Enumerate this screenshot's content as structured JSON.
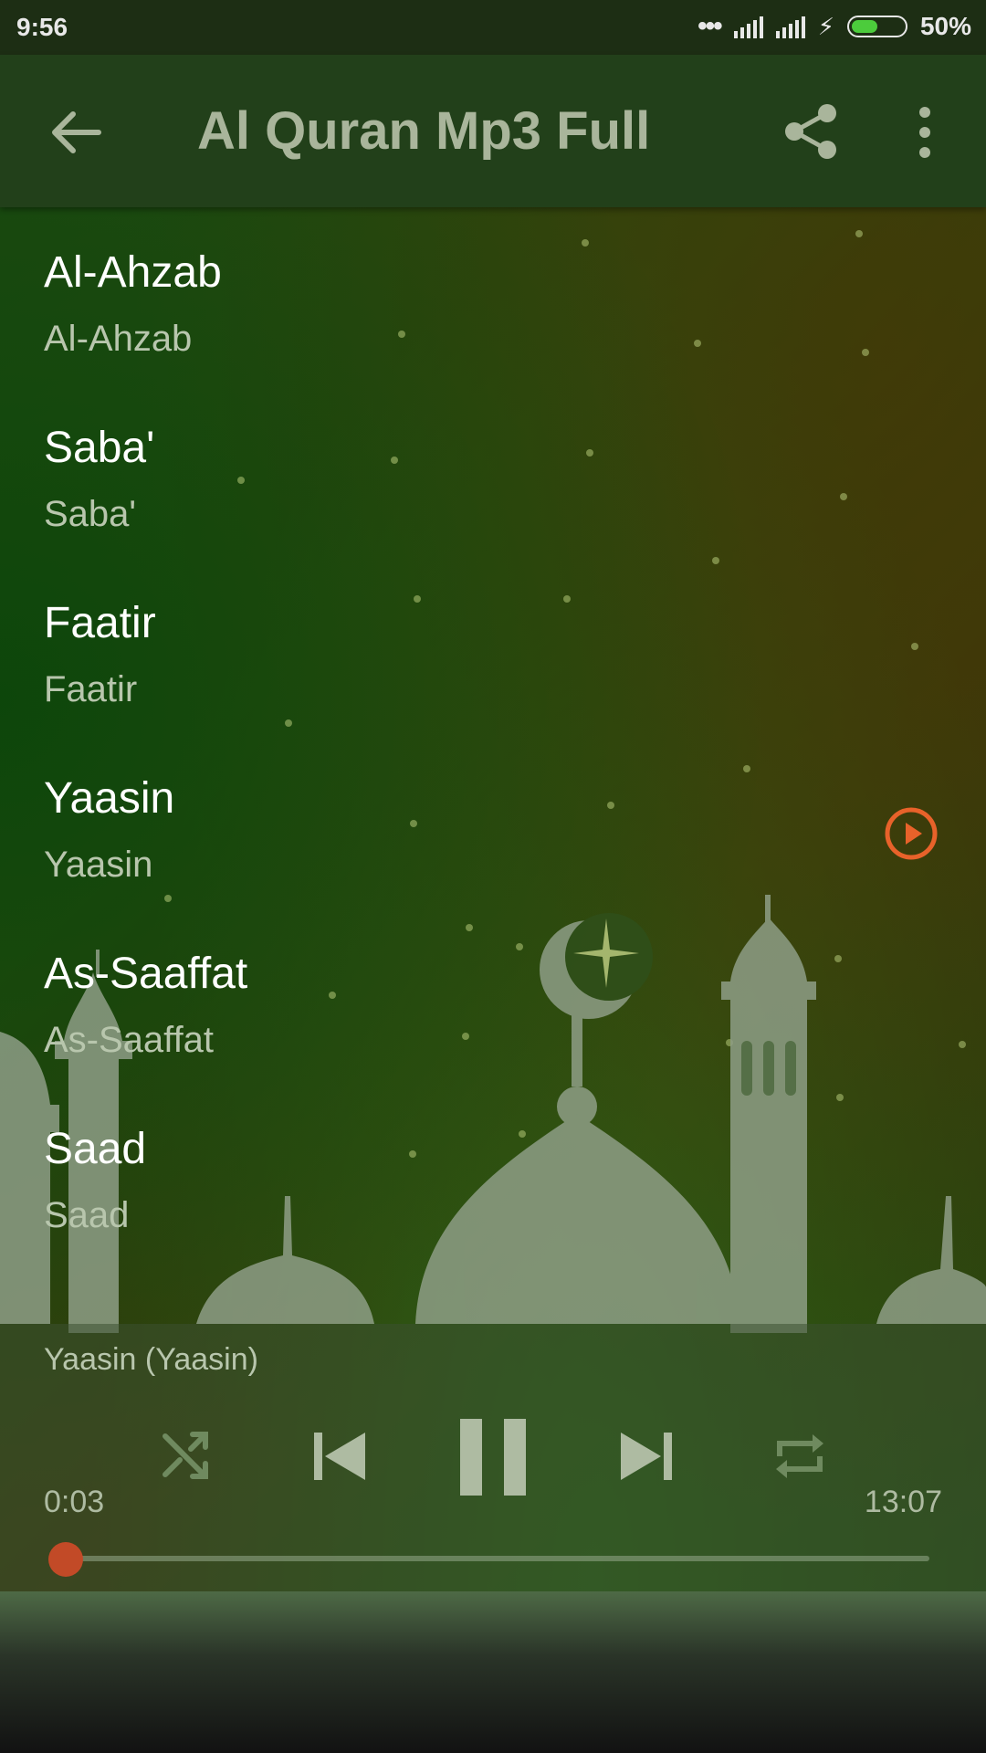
{
  "status_bar": {
    "time": "9:56",
    "battery": "50%",
    "battery_level": 0.5
  },
  "app_bar": {
    "title": "Al Quran Mp3 Full",
    "icons": [
      "arrow-left-icon",
      "share-icon",
      "more-vert-icon"
    ]
  },
  "tracks": [
    {
      "title": "Al-Ahzab",
      "subtitle": "Al-Ahzab"
    },
    {
      "title": "Saba'",
      "subtitle": "Saba'"
    },
    {
      "title": "Faatir",
      "subtitle": "Faatir"
    },
    {
      "title": "Yaasin",
      "subtitle": "Yaasin",
      "playing": true
    },
    {
      "title": "As-Saaffat",
      "subtitle": "As-Saaffat"
    },
    {
      "title": "Saad",
      "subtitle": "Saad"
    }
  ],
  "player": {
    "now_playing": "Yaasin (Yaasin)",
    "elapsed": "0:03",
    "total": "13:07",
    "progress": 0.004
  },
  "colors": {
    "accent": "#e8622a",
    "app_bar": "#22401a",
    "seek_thumb": "#c24a27"
  }
}
